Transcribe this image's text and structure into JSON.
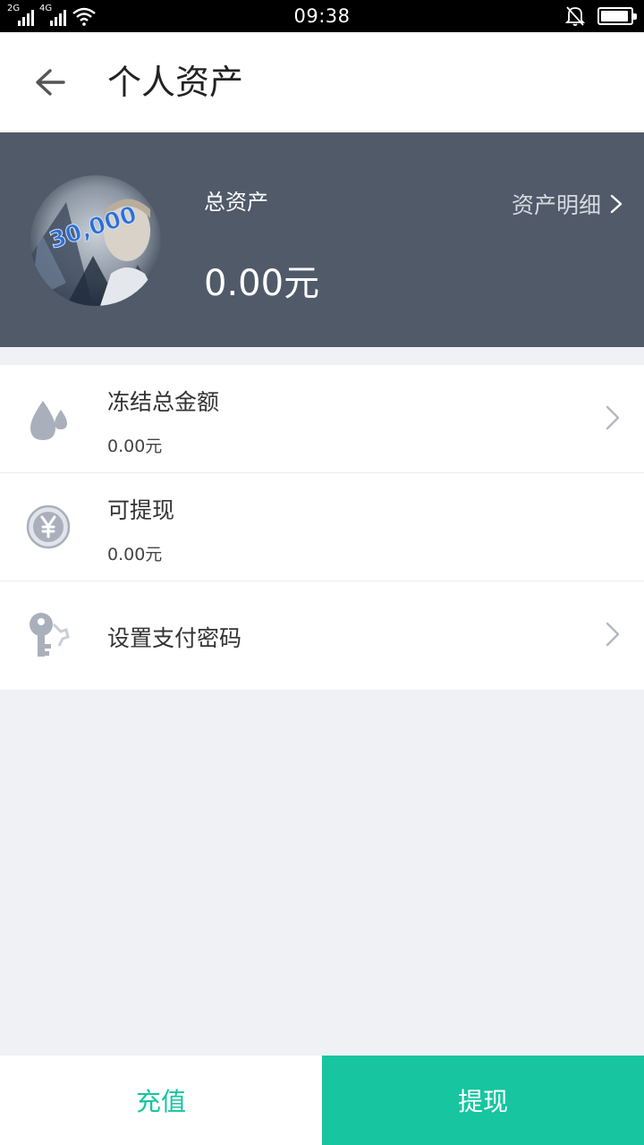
{
  "status_bar": {
    "time": "09:38",
    "sim1_label": "2G",
    "sim2_label": "4G",
    "battery_level": 0.95
  },
  "header": {
    "title": "个人资产",
    "back_icon": "back-arrow-icon"
  },
  "asset_panel": {
    "total_label": "总资产",
    "total_value": "0.00元",
    "detail_link": "资产明细",
    "panel_color": "#505a69"
  },
  "items": [
    {
      "title": "冻结总金额",
      "value": "0.00元",
      "icon": "water-drop-icon",
      "has_chevron": true
    },
    {
      "title": "可提现",
      "value": "0.00元",
      "icon": "yen-coin-icon",
      "has_chevron": false
    },
    {
      "title": "设置支付密码",
      "icon": "key-icon",
      "has_chevron": true
    }
  ],
  "bottom": {
    "recharge_label": "充值",
    "withdraw_label": "提现",
    "accent_color": "#17c5a0"
  }
}
